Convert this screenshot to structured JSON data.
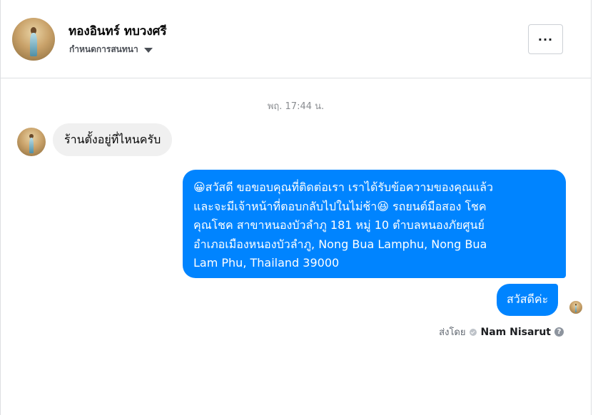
{
  "header": {
    "contact_name": "ทองอินทร์ ทบวงศรี",
    "nickname_label": "กำหนดการสนทนา",
    "more_label": "...",
    "avatar_icon": "profile-photo"
  },
  "thread": {
    "timestamp": "พฤ. 17:44 น.",
    "incoming": [
      {
        "text": "ร้านตั้งอยู่ที่ไหนครับ"
      }
    ],
    "outgoing": [
      {
        "lines": [
          "😀สวัสดี ขอขอบคุณที่ติดต่อเรา เราได้รับข้อความของคุณแล้ว",
          "และจะมีเจ้าหน้าที่ตอบกลับไปในไม่ช้า😆 รถยนต์มือสอง โชค",
          "คุณโชค สาขาหนองบัวลำภู 181 หมู่ 10  ตำบลหนองภัยศูนย์",
          "อำเภอเมืองหนองบัวลำภู, Nong Bua Lamphu, Nong Bua",
          "Lam Phu, Thailand 39000"
        ]
      },
      {
        "text": "สวัสดีค่ะ"
      }
    ],
    "sent_by_label": "ส่งโดย",
    "sent_by_name": "Nam Nisarut",
    "help_glyph": "?"
  },
  "colors": {
    "outgoing_bubble": "#0084ff",
    "incoming_bubble": "#f0f0f0",
    "divider": "#dddfe2"
  }
}
